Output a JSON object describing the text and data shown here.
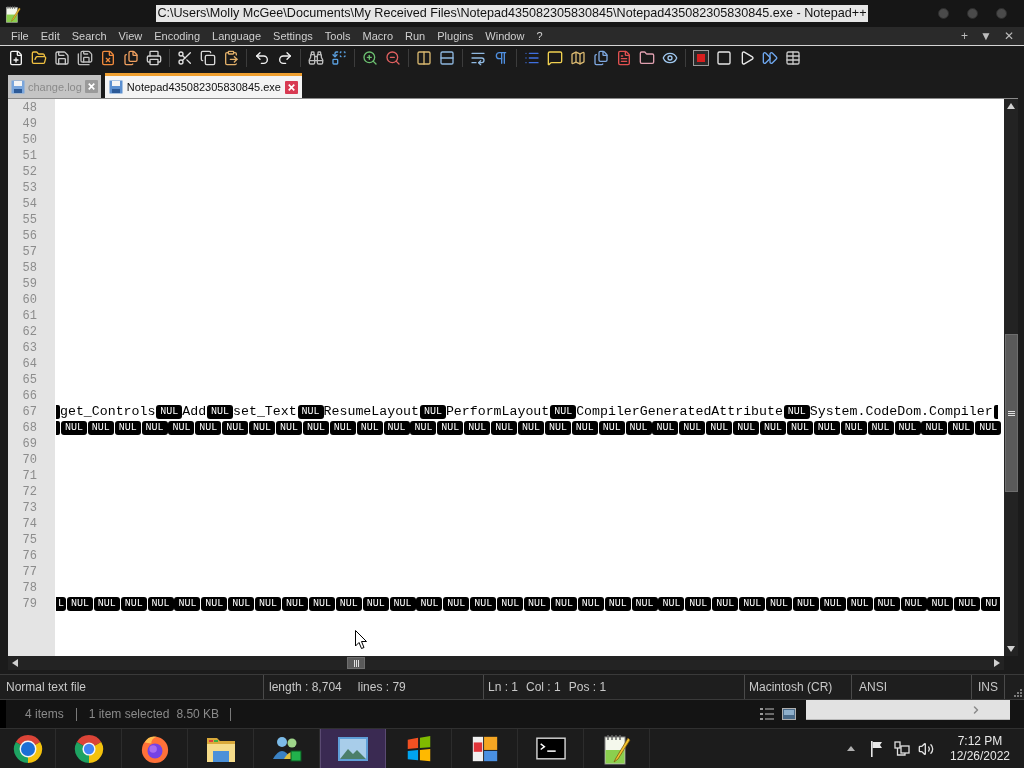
{
  "window": {
    "title": "C:\\Users\\Molly McGee\\Documents\\My Received Files\\Notepad435082305830845\\Notepad435082305830845.exe - Notepad++"
  },
  "menu": {
    "items": [
      "File",
      "Edit",
      "Search",
      "View",
      "Encoding",
      "Language",
      "Settings",
      "Tools",
      "Macro",
      "Run",
      "Plugins",
      "Window",
      "?"
    ],
    "window_controls": [
      "+",
      "▼",
      "✕"
    ]
  },
  "tabs": [
    {
      "label": "change.log",
      "selected": false
    },
    {
      "label": "Notepad435082305830845.exe",
      "selected": true
    }
  ],
  "editor": {
    "lines": [
      {
        "number": "48"
      },
      {
        "number": "49"
      },
      {
        "number": "50"
      },
      {
        "number": "51"
      },
      {
        "number": "52"
      },
      {
        "number": "53"
      },
      {
        "number": "54"
      },
      {
        "number": "55"
      },
      {
        "number": "56"
      },
      {
        "number": "57"
      },
      {
        "number": "58"
      },
      {
        "number": "59"
      },
      {
        "number": "60"
      },
      {
        "number": "61"
      },
      {
        "number": "62"
      },
      {
        "number": "63"
      },
      {
        "number": "64"
      },
      {
        "number": "65"
      },
      {
        "number": "66"
      },
      {
        "number": "67",
        "tokens": [
          {
            "kind": "fragment"
          },
          {
            "kind": "text",
            "text": "get_Controls"
          },
          {
            "kind": "control",
            "text": "NUL"
          },
          {
            "kind": "text",
            "text": "Add"
          },
          {
            "kind": "control",
            "text": "NUL"
          },
          {
            "kind": "text",
            "text": "set_Text"
          },
          {
            "kind": "control",
            "text": "NUL"
          },
          {
            "kind": "text",
            "text": "ResumeLayout"
          },
          {
            "kind": "control",
            "text": "NUL"
          },
          {
            "kind": "text",
            "text": "PerformLayout"
          },
          {
            "kind": "control",
            "text": "NUL"
          },
          {
            "kind": "text",
            "text": "CompilerGeneratedAttribute"
          },
          {
            "kind": "control",
            "text": "NUL"
          },
          {
            "kind": "text",
            "text": "System.CodeDom.Compiler"
          },
          {
            "kind": "fragment"
          }
        ]
      },
      {
        "number": "68",
        "tokens": [
          {
            "kind": "fragment"
          },
          {
            "kind": "control",
            "text": "NUL"
          },
          {
            "kind": "control",
            "text": "NUL"
          },
          {
            "kind": "control",
            "text": "NUL"
          },
          {
            "kind": "control",
            "text": "NUL"
          },
          {
            "kind": "control",
            "text": "NUL"
          },
          {
            "kind": "control",
            "text": "NUL"
          },
          {
            "kind": "control",
            "text": "NUL"
          },
          {
            "kind": "control",
            "text": "NUL"
          },
          {
            "kind": "control",
            "text": "NUL"
          },
          {
            "kind": "control",
            "text": "NUL"
          },
          {
            "kind": "control",
            "text": "NUL"
          },
          {
            "kind": "control",
            "text": "NUL"
          },
          {
            "kind": "control",
            "text": "NUL"
          },
          {
            "kind": "control",
            "text": "NUL"
          },
          {
            "kind": "control",
            "text": "NUL"
          },
          {
            "kind": "control",
            "text": "NUL"
          },
          {
            "kind": "control",
            "text": "NUL"
          },
          {
            "kind": "control",
            "text": "NUL"
          },
          {
            "kind": "control",
            "text": "NUL"
          },
          {
            "kind": "control",
            "text": "NUL"
          },
          {
            "kind": "control",
            "text": "NUL"
          },
          {
            "kind": "control",
            "text": "NUL"
          },
          {
            "kind": "control",
            "text": "NUL"
          },
          {
            "kind": "control",
            "text": "NUL"
          },
          {
            "kind": "control",
            "text": "NUL"
          },
          {
            "kind": "control",
            "text": "NUL"
          },
          {
            "kind": "control",
            "text": "NUL"
          },
          {
            "kind": "control",
            "text": "NUL"
          },
          {
            "kind": "control",
            "text": "NUL"
          },
          {
            "kind": "control",
            "text": "NUL"
          },
          {
            "kind": "control",
            "text": "NUL"
          },
          {
            "kind": "control",
            "text": "NUL"
          },
          {
            "kind": "control",
            "text": "NUL"
          },
          {
            "kind": "control",
            "text": "NUL"
          },
          {
            "kind": "control",
            "text": "NUL"
          }
        ]
      },
      {
        "number": "69"
      },
      {
        "number": "70"
      },
      {
        "number": "71"
      },
      {
        "number": "72"
      },
      {
        "number": "73"
      },
      {
        "number": "74"
      },
      {
        "number": "75"
      },
      {
        "number": "76"
      },
      {
        "number": "77"
      },
      {
        "number": "78"
      },
      {
        "number": "79",
        "tokens": [
          {
            "kind": "fragment",
            "text": "L"
          },
          {
            "kind": "control",
            "text": "NUL"
          },
          {
            "kind": "control",
            "text": "NUL"
          },
          {
            "kind": "control",
            "text": "NUL"
          },
          {
            "kind": "control",
            "text": "NUL"
          },
          {
            "kind": "control",
            "text": "NUL"
          },
          {
            "kind": "control",
            "text": "NUL"
          },
          {
            "kind": "control",
            "text": "NUL"
          },
          {
            "kind": "control",
            "text": "NUL"
          },
          {
            "kind": "control",
            "text": "NUL"
          },
          {
            "kind": "control",
            "text": "NUL"
          },
          {
            "kind": "control",
            "text": "NUL"
          },
          {
            "kind": "control",
            "text": "NUL"
          },
          {
            "kind": "control",
            "text": "NUL"
          },
          {
            "kind": "control",
            "text": "NUL"
          },
          {
            "kind": "control",
            "text": "NUL"
          },
          {
            "kind": "control",
            "text": "NUL"
          },
          {
            "kind": "control",
            "text": "NUL"
          },
          {
            "kind": "control",
            "text": "NUL"
          },
          {
            "kind": "control",
            "text": "NUL"
          },
          {
            "kind": "control",
            "text": "NUL"
          },
          {
            "kind": "control",
            "text": "NUL"
          },
          {
            "kind": "control",
            "text": "NUL"
          },
          {
            "kind": "control",
            "text": "NUL"
          },
          {
            "kind": "control",
            "text": "NUL"
          },
          {
            "kind": "control",
            "text": "NUL"
          },
          {
            "kind": "control",
            "text": "NUL"
          },
          {
            "kind": "control",
            "text": "NUL"
          },
          {
            "kind": "control",
            "text": "NUL"
          },
          {
            "kind": "control",
            "text": "NUL"
          },
          {
            "kind": "control",
            "text": "NUL"
          },
          {
            "kind": "control",
            "text": "NUL"
          },
          {
            "kind": "control",
            "text": "NUL"
          },
          {
            "kind": "control",
            "text": "NUL"
          },
          {
            "kind": "control",
            "text": "NUL"
          },
          {
            "kind": "fragment",
            "text": "NU"
          }
        ]
      }
    ]
  },
  "status_bar": {
    "file_type": "Normal text file",
    "length": "length : 8,704",
    "lines": "lines : 79",
    "line": "Ln : 1",
    "column": "Col : 1",
    "position": "Pos : 1",
    "eol": "Macintosh (CR)",
    "encoding": "ANSI",
    "mode": "INS"
  },
  "explorer_status": {
    "items": "4 items",
    "selection": "1 item selected",
    "size": "8.50 KB"
  },
  "taskbar": {
    "buttons": [
      {
        "kind": "chromium",
        "selected": false
      },
      {
        "kind": "chrome",
        "selected": false
      },
      {
        "kind": "firefox",
        "selected": false
      },
      {
        "kind": "explorer",
        "selected": false
      },
      {
        "kind": "messenger",
        "selected": false
      },
      {
        "kind": "photos",
        "selected": true
      },
      {
        "kind": "flag",
        "selected": false
      },
      {
        "kind": "tiles",
        "selected": false
      },
      {
        "kind": "terminal",
        "selected": false
      },
      {
        "kind": "notepad",
        "selected": false
      }
    ],
    "clock": {
      "time": "7:12 PM",
      "date": "12/26/2022"
    }
  }
}
